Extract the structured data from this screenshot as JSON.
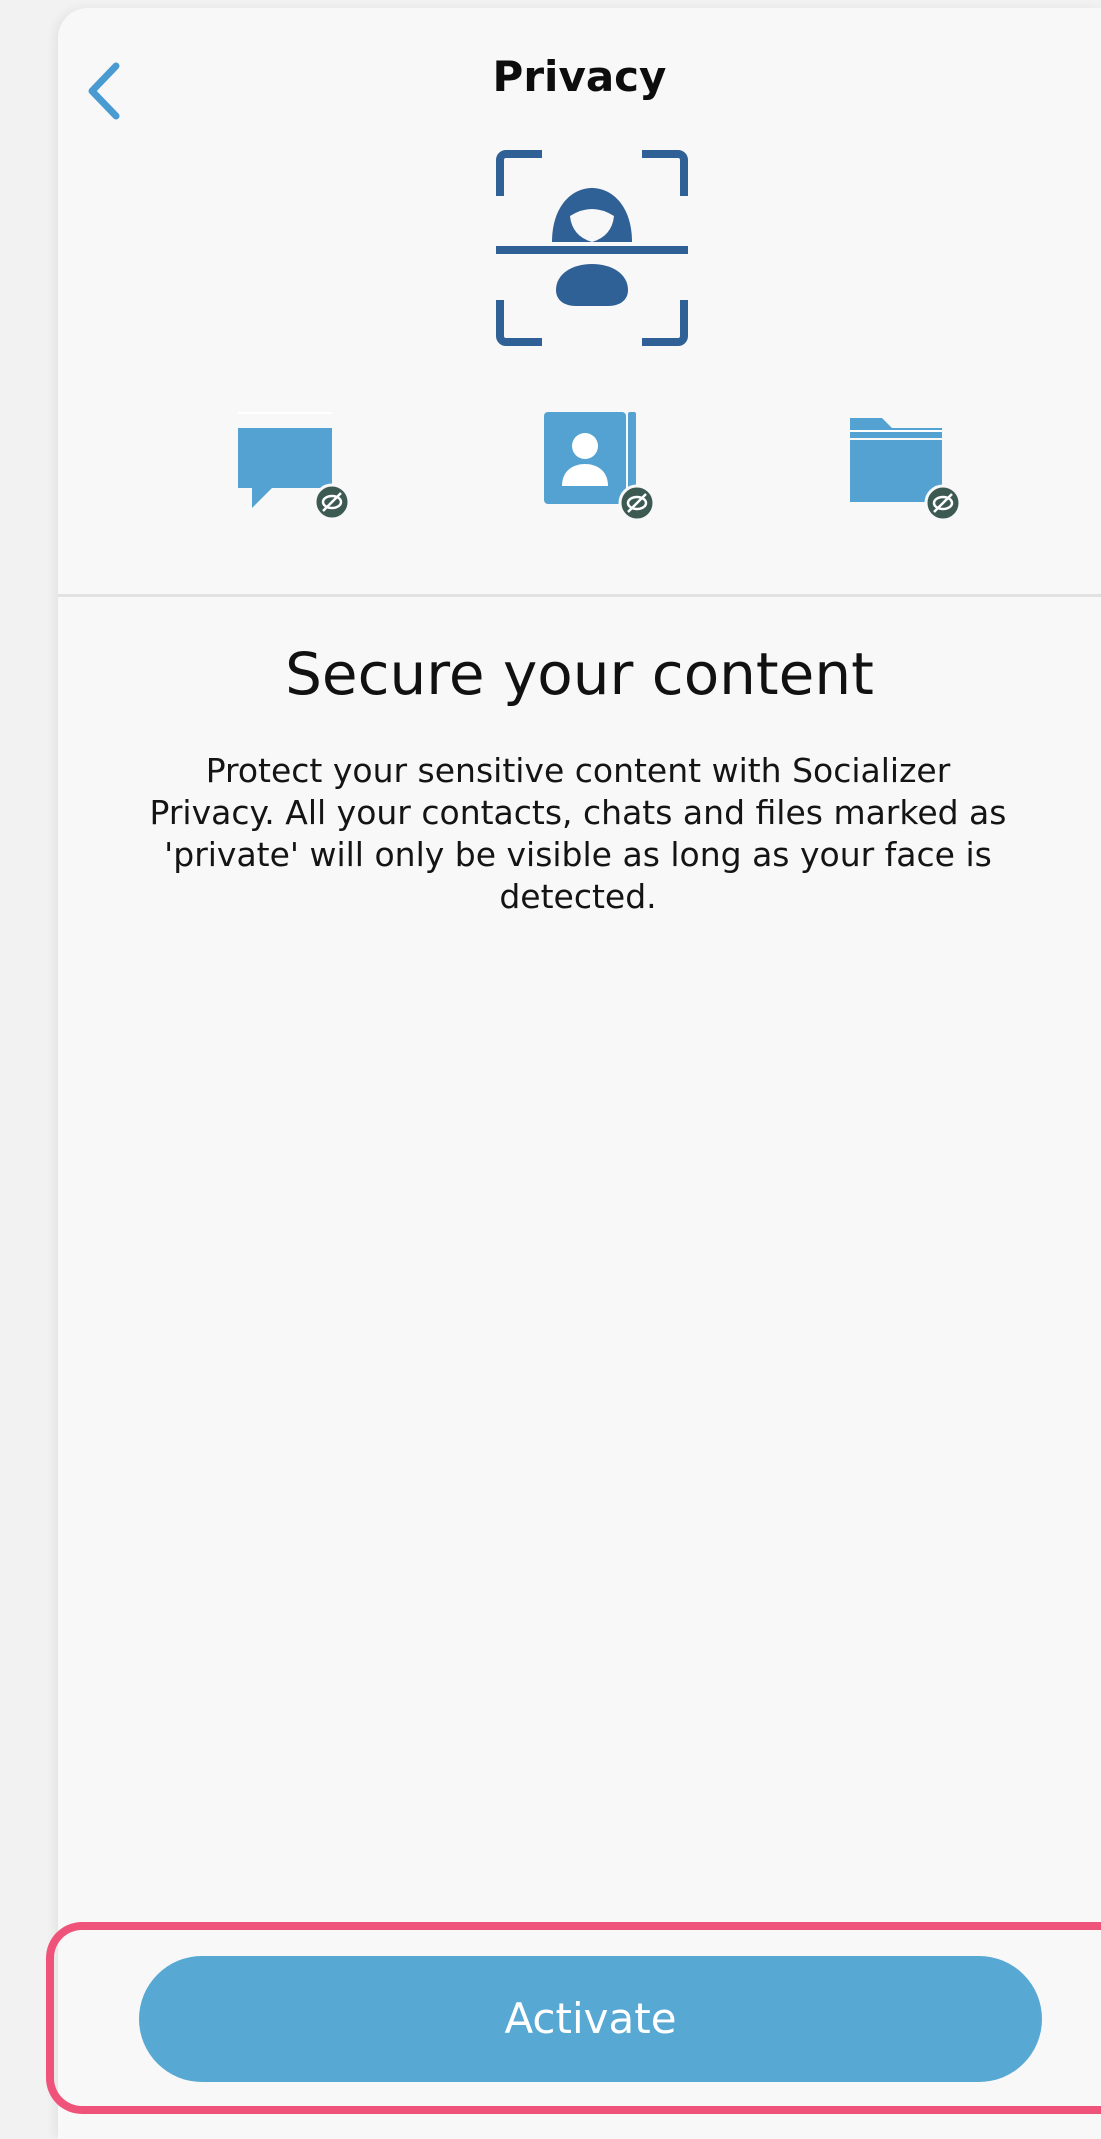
{
  "header": {
    "title": "Privacy",
    "back_icon": "chevron-left-icon"
  },
  "hero": {
    "icon": "face-scan-icon",
    "features": [
      {
        "icon": "chat-bubble-icon",
        "badge": "eye-slash-icon"
      },
      {
        "icon": "contact-card-icon",
        "badge": "eye-slash-icon"
      },
      {
        "icon": "folder-icon",
        "badge": "eye-slash-icon"
      }
    ]
  },
  "content": {
    "headline": "Secure your content",
    "description": "Protect your sensitive content with Socializer Privacy. All your contacts, chats and files marked as 'private' will only be visible as long as your face is detected."
  },
  "footer": {
    "activate_label": "Activate"
  },
  "colors": {
    "accent": "#58a8d4",
    "icon_dark_blue": "#2f6196",
    "icon_light_blue": "#54a2d2",
    "badge": "#3d5a52",
    "highlight": "#f0537a"
  }
}
